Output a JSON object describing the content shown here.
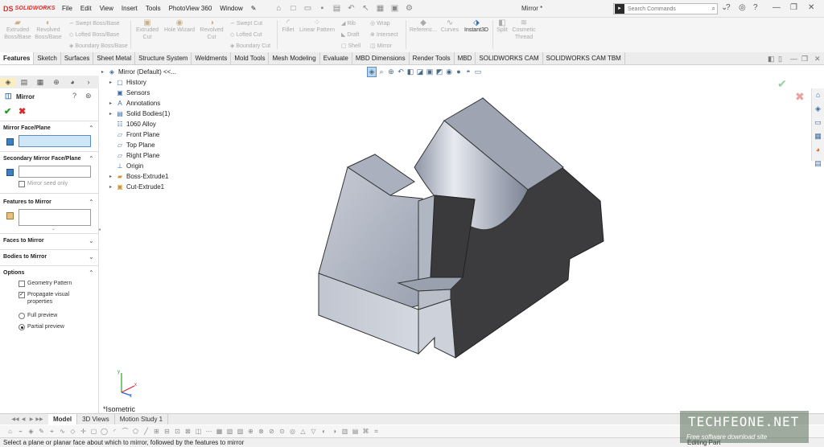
{
  "app": {
    "brand_short": "DS",
    "brand_name": "SOLIDWORKS"
  },
  "menu": [
    "File",
    "Edit",
    "View",
    "Insert",
    "Tools",
    "PhotoView 360",
    "Window"
  ],
  "document_title": "Mirror *",
  "search": {
    "placeholder": "Search Commands"
  },
  "commands": {
    "extruded_boss": "Extruded Boss/Base",
    "revolved_boss": "Revolved Boss/Base",
    "swept_boss": "Swept Boss/Base",
    "lofted_boss": "Lofted Boss/Base",
    "boundary_boss": "Boundary Boss/Base",
    "extruded_cut": "Extruded Cut",
    "hole_wizard": "Hole Wizard",
    "revolved_cut": "Revolved Cut",
    "swept_cut": "Swept Cut",
    "lofted_cut": "Lofted Cut",
    "boundary_cut": "Boundary Cut",
    "fillet": "Fillet",
    "linear_pattern": "Linear Pattern",
    "rib": "Rib",
    "draft": "Draft",
    "shell": "Shell",
    "wrap": "Wrap",
    "intersect": "Intersect",
    "mirror": "Mirror",
    "reference": "Referenc...",
    "curves": "Curves",
    "instant3d": "Instant3D",
    "split": "Split",
    "cosmetic_thread": "Cosmetic Thread"
  },
  "tabs": [
    "Features",
    "Sketch",
    "Surfaces",
    "Sheet Metal",
    "Structure System",
    "Weldments",
    "Mold Tools",
    "Mesh Modeling",
    "Evaluate",
    "MBD Dimensions",
    "Render Tools",
    "MBD",
    "SOLIDWORKS CAM",
    "SOLIDWORKS CAM TBM"
  ],
  "property_manager": {
    "title": "Mirror",
    "sections": {
      "mirror_face": "Mirror Face/Plane",
      "secondary_mirror_face": "Secondary Mirror Face/Plane",
      "mirror_seed_only": "Mirror seed only",
      "features_to_mirror": "Features to Mirror",
      "faces_to_mirror": "Faces to Mirror",
      "bodies_to_mirror": "Bodies to Mirror",
      "options": "Options"
    },
    "options": {
      "geometry_pattern": "Geometry Pattern",
      "propagate_visual": "Propagate visual properties",
      "full_preview": "Full preview",
      "partial_preview": "Partial preview"
    }
  },
  "tree": {
    "root": "Mirror (Default) <<...",
    "items": [
      "History",
      "Sensors",
      "Annotations",
      "Solid Bodies(1)",
      "1060 Alloy",
      "Front Plane",
      "Top Plane",
      "Right Plane",
      "Origin",
      "Boss-Extrude1",
      "Cut-Extrude1"
    ]
  },
  "view_label": "*Isometric",
  "bottom_tabs": [
    "Model",
    "3D Views",
    "Motion Study 1"
  ],
  "status": {
    "message": "Select a plane or planar face about which to mirror, followed by the features to mirror",
    "state": "Editing Part"
  },
  "watermark": {
    "brand": "TECHFEONE.NET",
    "tagline": "Free software download site"
  },
  "colors": {
    "accent_red": "#d92b27",
    "ok_green": "#1a9a1a",
    "selection_blue": "#cfe6f7"
  }
}
